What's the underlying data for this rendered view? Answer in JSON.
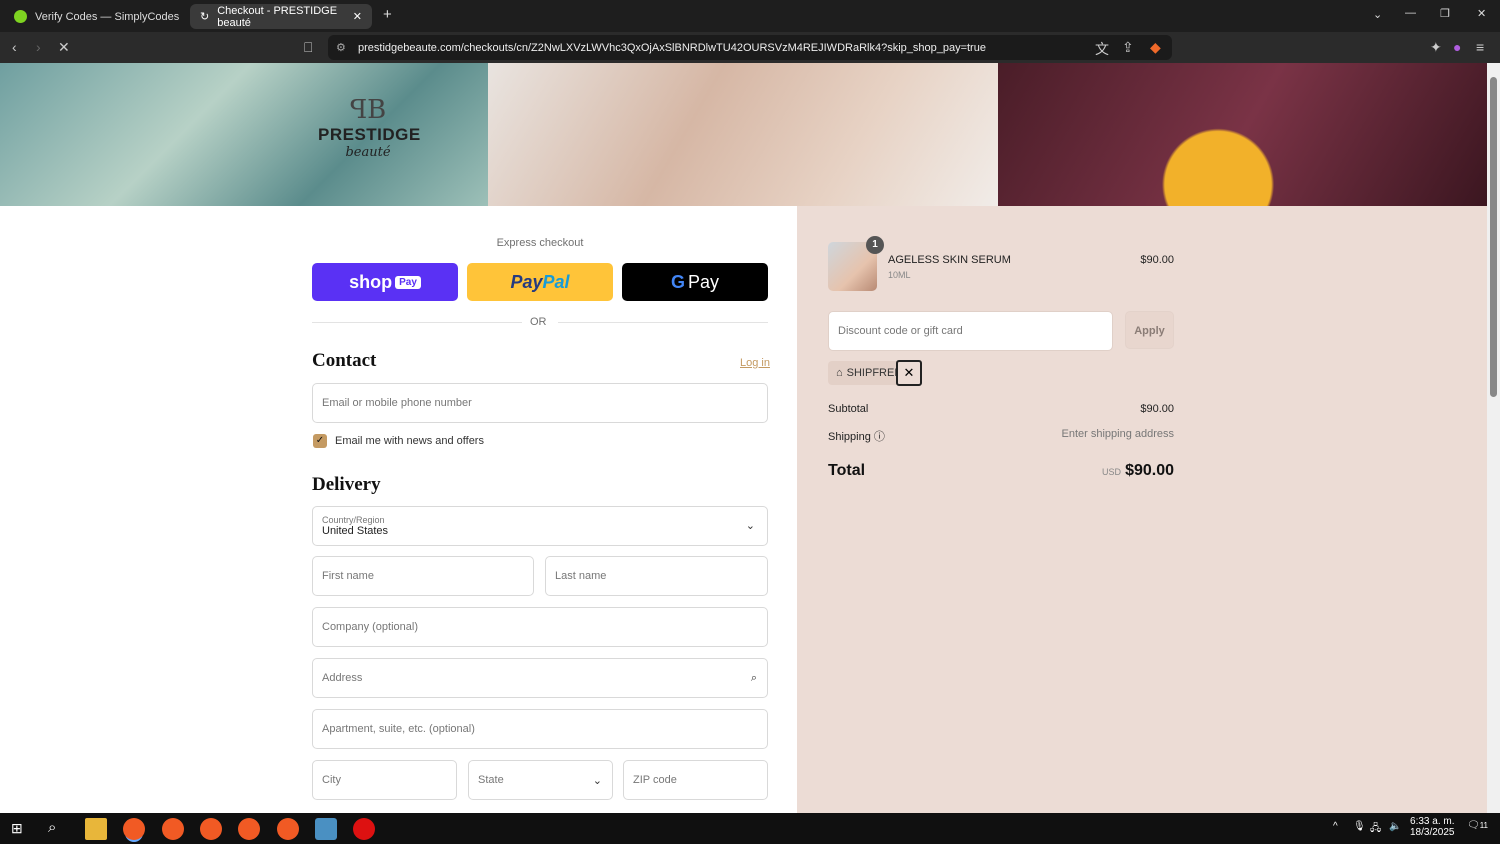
{
  "browser": {
    "tabs": [
      {
        "label": "Verify Codes — SimplyCodes"
      },
      {
        "label": "Checkout - PRESTIDGE beauté"
      }
    ],
    "url": "prestidgebeaute.com/checkouts/cn/Z2NwLXVzLWVhc3QxOjAxSlBNRDlwTU42OURSVzM4REJIWDRaRlk4?skip_shop_pay=true"
  },
  "brand": {
    "name": "PRESTIDGE",
    "sub": "beauté"
  },
  "express": {
    "label": "Express checkout",
    "shop": "shop",
    "shop_pay": "Pay",
    "paypal_a": "Pay",
    "paypal_b": "Pal",
    "gpay": "Pay",
    "or": "OR"
  },
  "contact": {
    "title": "Contact",
    "login": "Log in",
    "email_placeholder": "Email or mobile phone number",
    "newsletter": "Email me with news and offers",
    "newsletter_checked": true
  },
  "delivery": {
    "title": "Delivery",
    "country_label": "Country/Region",
    "country": "United States",
    "first": "First name",
    "last": "Last name",
    "company": "Company (optional)",
    "address": "Address",
    "apt": "Apartment, suite, etc. (optional)",
    "city": "City",
    "state": "State",
    "zip": "ZIP code"
  },
  "summary": {
    "item": {
      "name": "AGELESS SKIN SERUM",
      "variant": "10ML",
      "price": "$90.00",
      "qty": "1"
    },
    "discount_placeholder": "Discount code or gift card",
    "apply": "Apply",
    "code": "SHIPFREE",
    "subtotal_label": "Subtotal",
    "subtotal": "$90.00",
    "shipping_label": "Shipping",
    "shipping": "Enter shipping address",
    "total_label": "Total",
    "currency": "USD",
    "total": "$90.00"
  },
  "taskbar": {
    "time": "6:33 a. m.",
    "date": "18/3/2025",
    "notifications": "11"
  },
  "colors": {
    "shop_pay": "#5a31f4",
    "paypal": "#ffc439",
    "accent": "#c49a62",
    "sidebar": "#ecdcd5"
  }
}
